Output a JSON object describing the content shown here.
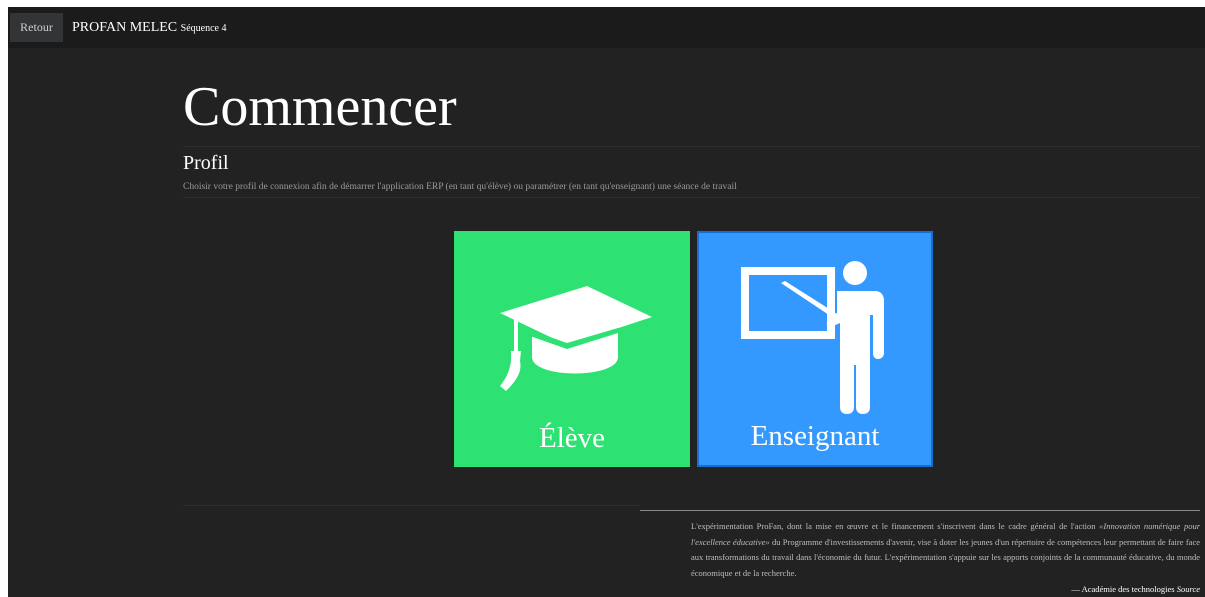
{
  "topbar": {
    "back_label": "Retour",
    "app_name": "PROFAN MELEC",
    "sequence": "Séquence 4"
  },
  "page": {
    "title": "Commencer",
    "section_title": "Profil",
    "section_desc": "Choisir votre profil de connexion afin de démarrer l'application ERP (en tant qu'élève) ou paramétrer (en tant qu'enseignant) une séance de travail"
  },
  "profiles": {
    "student": {
      "label": "Élève",
      "icon": "graduation-cap-icon",
      "color": "#2de173"
    },
    "teacher": {
      "label": "Enseignant",
      "icon": "teacher-board-icon",
      "color": "#3499ff"
    }
  },
  "quote": {
    "part1": "L'expérimentation ProFan, dont la mise en œuvre et le financement s'inscrivent dans le cadre général de l'action ",
    "emphasis": "«Innovation numérique pour l'excellence éducative»",
    "part2": " du Programme d'investissements d'avenir, vise à doter les jeunes d'un répertoire de compétences leur permettant de faire face aux transformations du travail dans l'économie du futur. L'expérimentation s'appuie sur les apports conjoints de la communauté éducative, du monde économique et de la recherche.",
    "author": "— Académie des technologies",
    "source_label": "Source"
  }
}
